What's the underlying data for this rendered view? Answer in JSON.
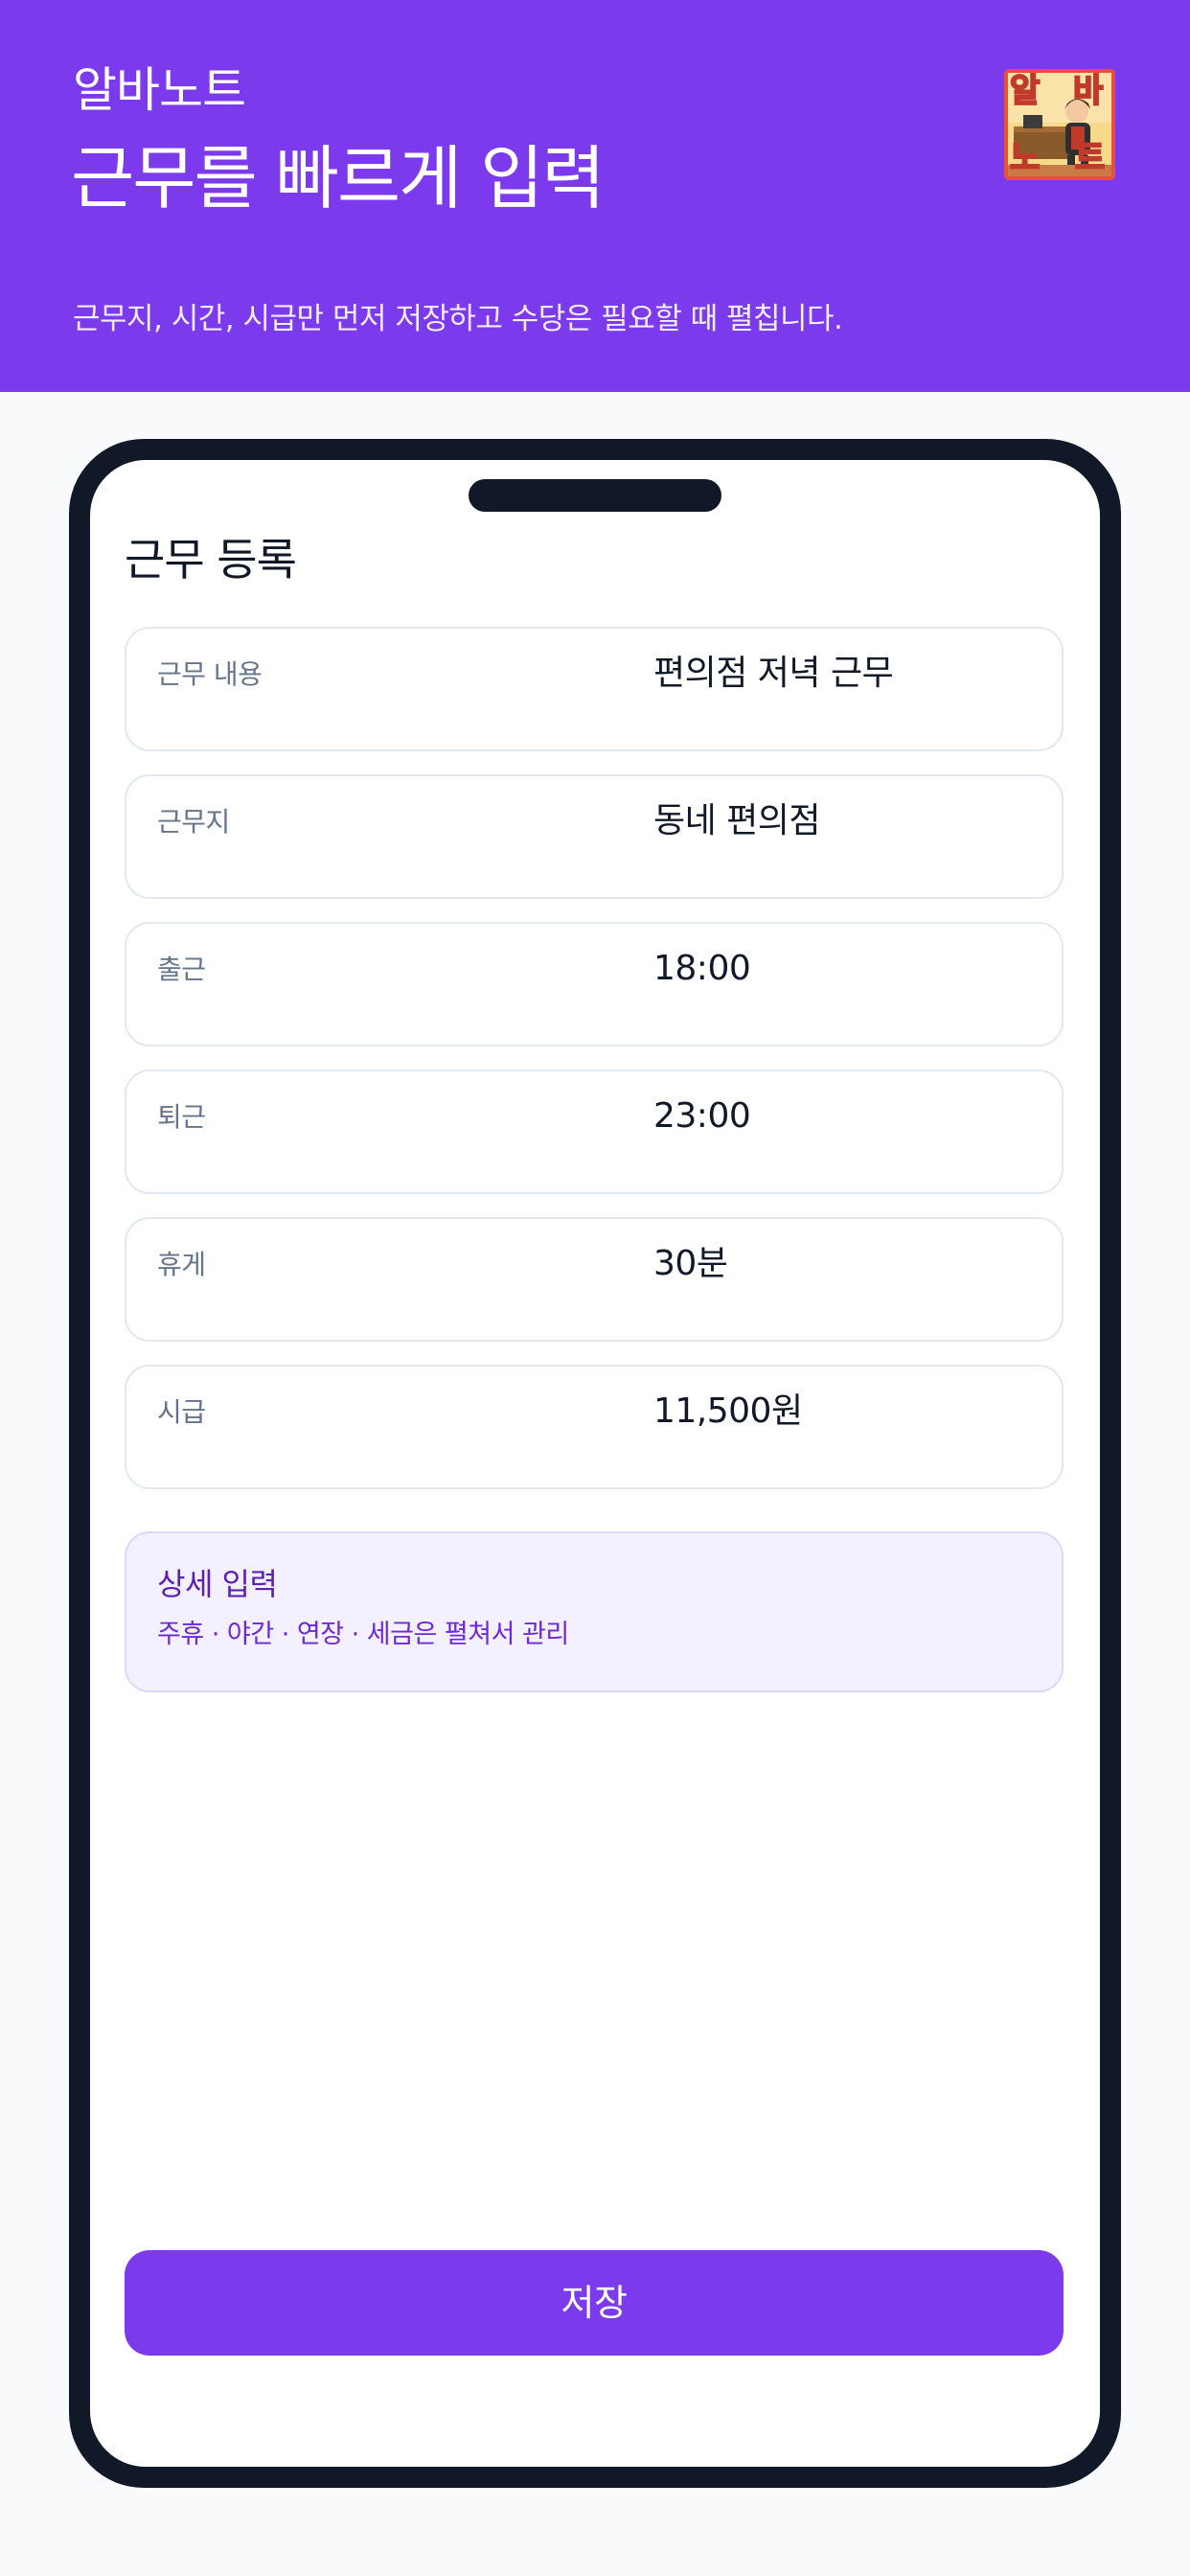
{
  "header": {
    "app_name": "알바노트",
    "headline": "근무를 빠르게 입력",
    "tagline": "근무지, 시간, 시급만 먼저 저장하고 수당은 필요할 때 펼칩니다.",
    "logo_text": [
      "알",
      "바",
      "노",
      "트"
    ],
    "background": "#7C3AED"
  },
  "form": {
    "title": "근무 등록",
    "fields": [
      {
        "label": "근무 내용",
        "value": "편의점 저녁 근무"
      },
      {
        "label": "근무지",
        "value": "동네 편의점"
      },
      {
        "label": "출근",
        "value": "18:00"
      },
      {
        "label": "퇴근",
        "value": "23:00"
      },
      {
        "label": "휴게",
        "value": "30분"
      },
      {
        "label": "시급",
        "value": "11,500원"
      }
    ],
    "detail": {
      "title": "상세 입력",
      "subtitle": "주휴 · 야간 · 연장 · 세금은 펼쳐서 관리"
    },
    "save_label": "저장"
  },
  "colors": {
    "accent": "#7C3AED",
    "frame": "#111827",
    "detail_bg": "#F3F0FF"
  }
}
